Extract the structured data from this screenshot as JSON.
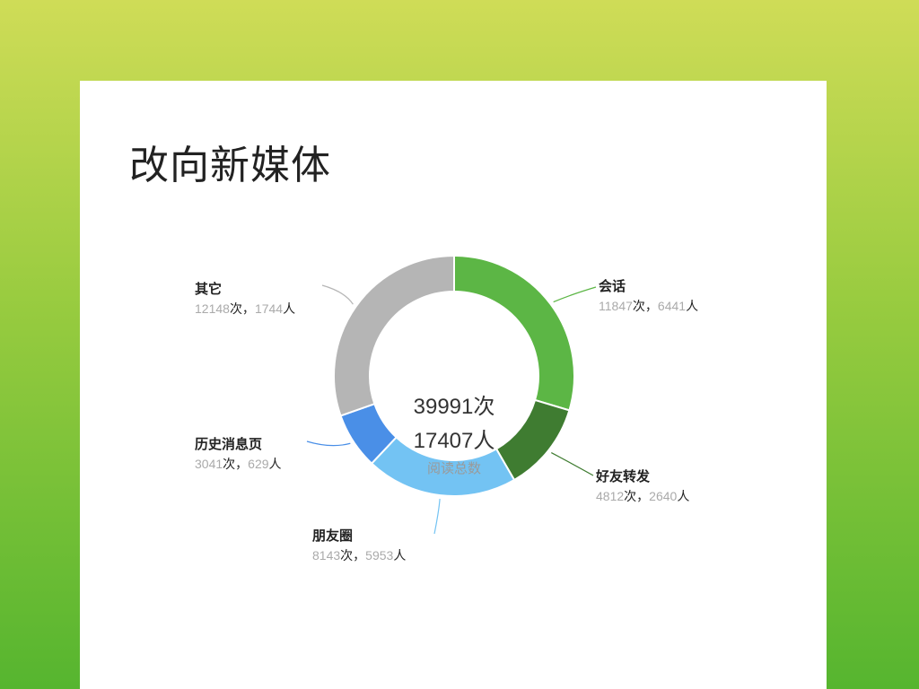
{
  "page": {
    "title": "改向新媒体"
  },
  "center": {
    "total_reads": "39991次",
    "total_people": "17407人",
    "caption": "阅读总数"
  },
  "units": {
    "reads": "次，",
    "people": "人"
  },
  "chart_data": {
    "type": "pie",
    "donut": true,
    "slices": [
      {
        "label": "会话",
        "reads": 11847,
        "people": 6441,
        "color": "#5cb645"
      },
      {
        "label": "好友转发",
        "reads": 4812,
        "people": 2640,
        "color": "#3f7c31"
      },
      {
        "label": "朋友圈",
        "reads": 8143,
        "people": 5953,
        "color": "#73c3f3"
      },
      {
        "label": "历史消息页",
        "reads": 3041,
        "people": 629,
        "color": "#4a8fe7"
      },
      {
        "label": "其它",
        "reads": 12148,
        "people": 1744,
        "color": "#b5b5b5"
      }
    ],
    "total_reads": 39991,
    "total_people": 17407
  }
}
